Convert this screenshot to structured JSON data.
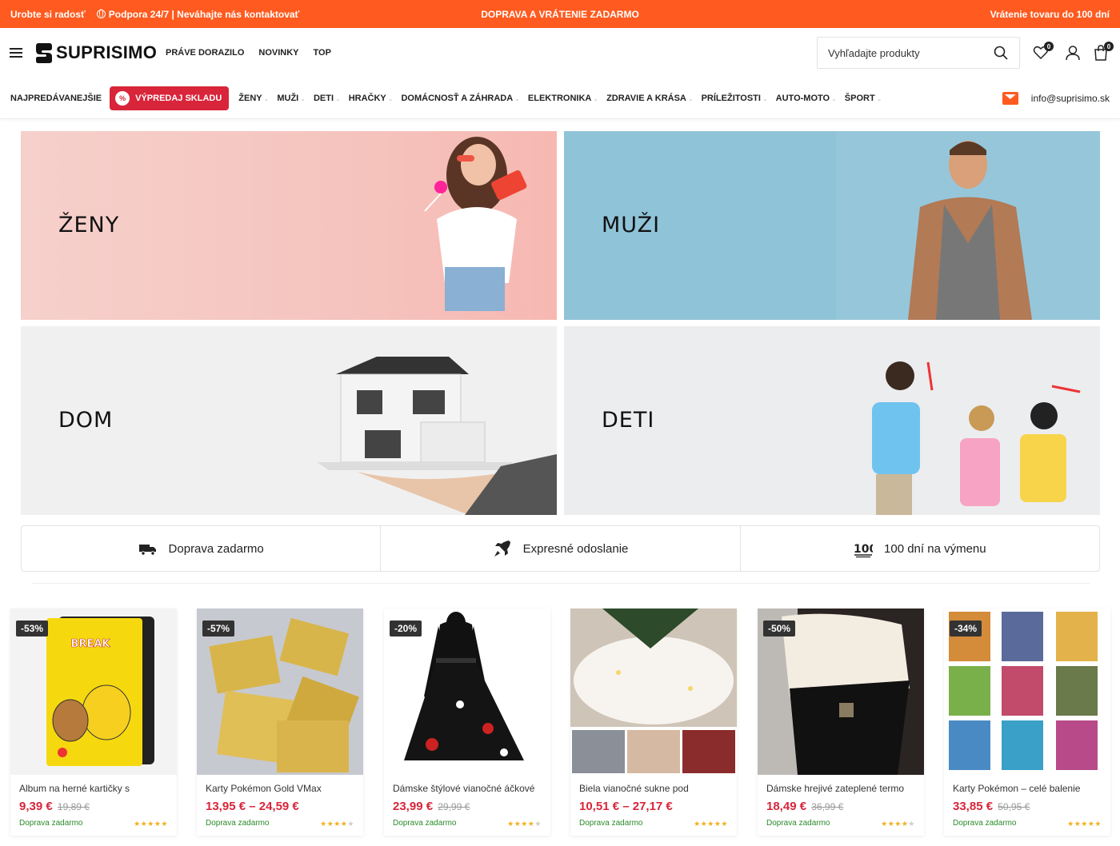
{
  "topbar": {
    "left_1": "Urobte si radosť",
    "left_2": "Podpora 24/7 | Neváhajte nás kontaktovať",
    "center": "DOPRAVA A VRÁTENIE ZADARMO",
    "right": "Vrátenie tovaru do 100 dní"
  },
  "header": {
    "logo": "SUPRISIMO",
    "nav": [
      "PRÁVE DORAZILO",
      "NOVINKY",
      "TOP"
    ],
    "search_placeholder": "Vyhľadajte produkty",
    "wishlist_count": "0",
    "cart_count": "0"
  },
  "catnav": {
    "first": "NAJPREDÁVANEJŠIE",
    "sale": "VÝPREDAJ SKLADU",
    "sale_icon": "%",
    "items": [
      "ŽENY",
      "MUŽI",
      "DETI",
      "HRAČKY",
      "DOMÁCNOSŤ A ZÁHRADA",
      "ELEKTRONIKA",
      "ZDRAVIE A KRÁSA",
      "PRÍLEŽITOSTI",
      "AUTO-MOTO",
      "ŠPORT"
    ],
    "email": "info@suprisimo.sk"
  },
  "banners": [
    "ŽENY",
    "MUŽI",
    "DOM",
    "DETI"
  ],
  "features": [
    {
      "icon": "truck-icon",
      "label": "Doprava zadarmo"
    },
    {
      "icon": "rocket-icon",
      "label": "Expresné odoslanie"
    },
    {
      "icon": "hundred-icon",
      "label": "100 dní na výmenu"
    }
  ],
  "products": [
    {
      "discount": "-53%",
      "name": "Album na herné kartičky s",
      "price": "9,39 €",
      "old": "19,89 €",
      "ship": "Doprava zadarmo",
      "rating": 5
    },
    {
      "discount": "-57%",
      "name": "Karty Pokémon Gold VMax",
      "price": "13,95 € – 24,59 €",
      "old": "",
      "ship": "Doprava zadarmo",
      "rating": 4
    },
    {
      "discount": "-20%",
      "name": "Dámske štýlové vianočné áčkové",
      "price": "23,99 €",
      "old": "29,99 €",
      "ship": "Doprava zadarmo",
      "rating": 4
    },
    {
      "discount": "",
      "name": "Biela vianočné sukne pod",
      "price": "10,51 € – 27,17 €",
      "old": "",
      "ship": "Doprava zadarmo",
      "rating": 5
    },
    {
      "discount": "-50%",
      "name": "Dámske hrejivé zateplené termo",
      "price": "18,49 €",
      "old": "36,99 €",
      "ship": "Doprava zadarmo",
      "rating": 4
    },
    {
      "discount": "-34%",
      "name": "Karty Pokémon – celé balenie",
      "price": "33,85 €",
      "old": "50,95 €",
      "ship": "Doprava zadarmo",
      "rating": 5
    }
  ],
  "colors": {
    "accent": "#ff5a1f",
    "sale": "#d8253a",
    "price": "#d8253a",
    "shipping": "#2a8a2a"
  }
}
